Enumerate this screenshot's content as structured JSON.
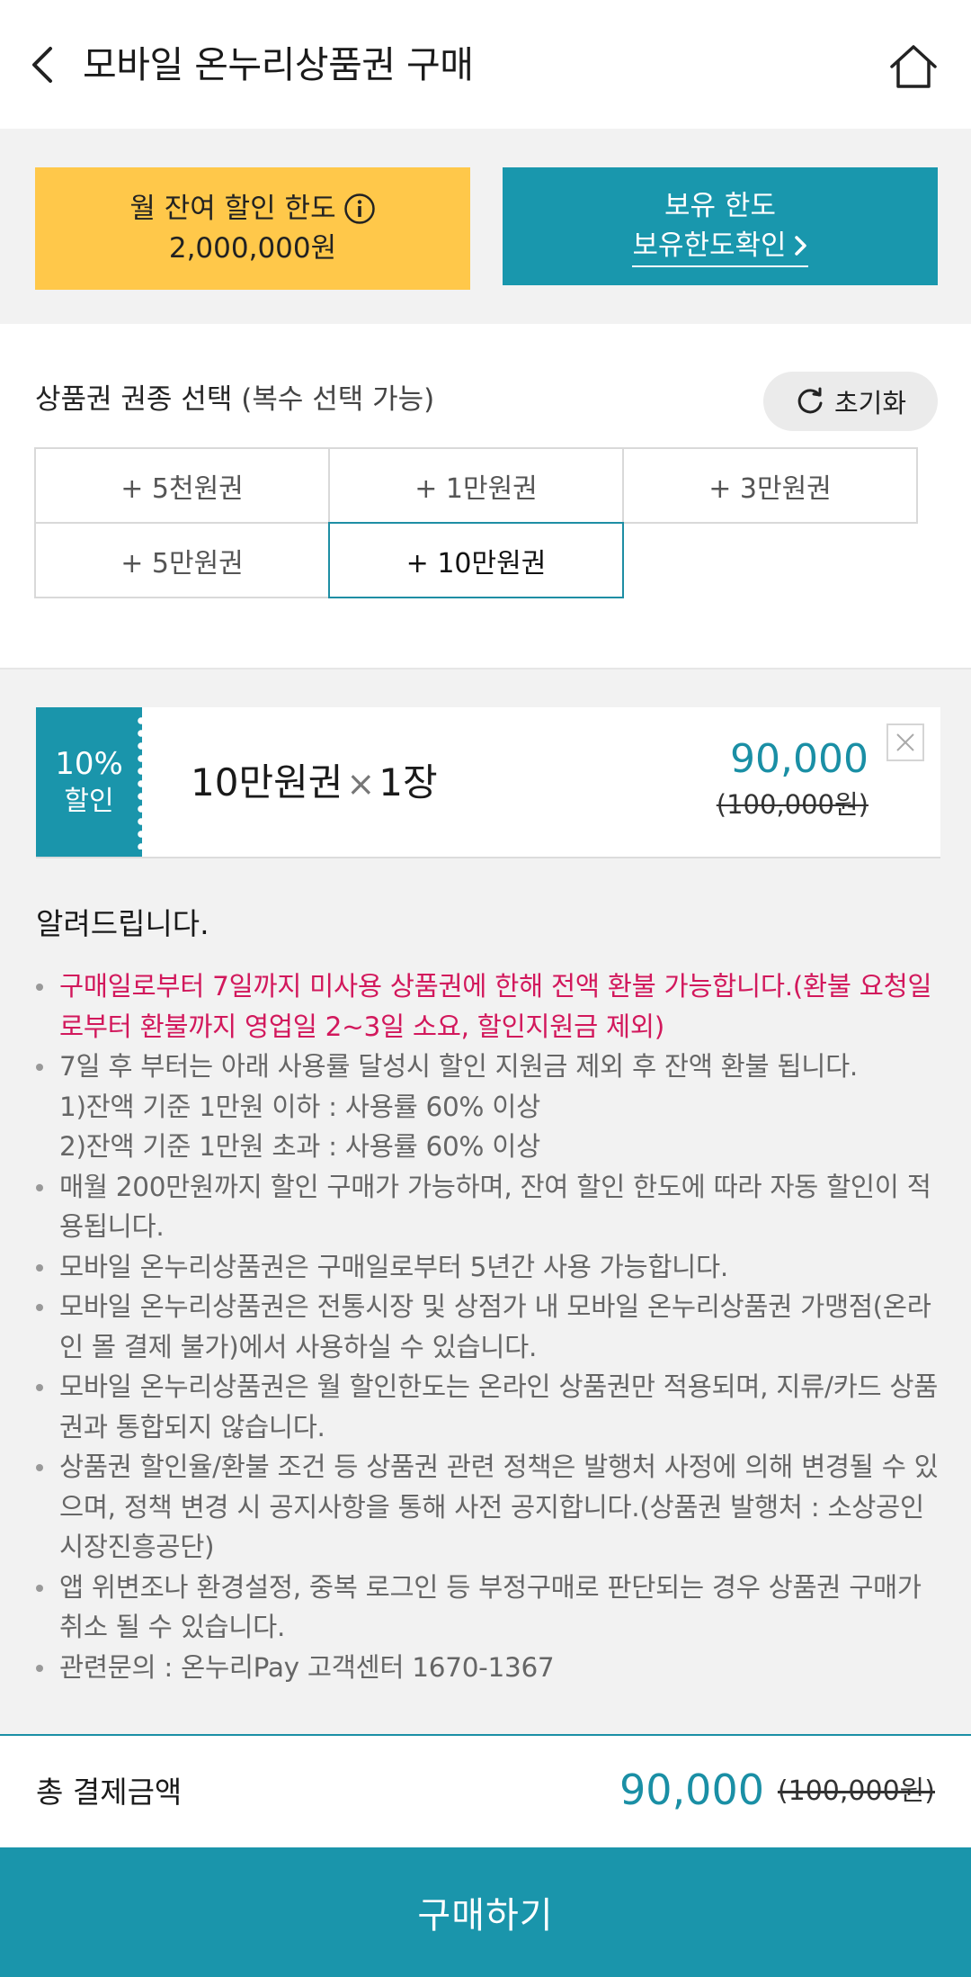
{
  "header": {
    "title": "모바일 온누리상품권 구매",
    "back_icon": "chevron-left-icon",
    "home_icon": "home-icon"
  },
  "limits": {
    "monthly_label": "월 잔여 할인 한도",
    "monthly_value": "2,000,000원",
    "holding_label": "보유 한도",
    "holding_link": "보유한도확인"
  },
  "selection": {
    "title": "상품권 권종 선택",
    "title_sub": "(복수 선택 가능)",
    "reset_label": "초기화",
    "options": [
      {
        "label": "+ 5천원권",
        "selected": false
      },
      {
        "label": "+ 1만원권",
        "selected": false
      },
      {
        "label": "+ 3만원권",
        "selected": false
      },
      {
        "label": "+ 5만원권",
        "selected": false
      },
      {
        "label": "+ 10만원권",
        "selected": true
      }
    ]
  },
  "cart": {
    "badge_percent": "10%",
    "badge_text": "할인",
    "item_name": "10만원권",
    "item_times": "×",
    "item_qty": "1장",
    "item_price": "90,000",
    "item_original": "(100,000원)"
  },
  "notice": {
    "title": "알려드립니다.",
    "items": [
      "구매일로부터 7일까지 미사용 상품권에 한해 전액 환불 가능합니다.(환불 요청일로부터 환불까지 영업일 2~3일 소요, 할인지원금 제외)",
      "7일 후 부터는 아래 사용률 달성시 할인 지원금 제외 후 잔액 환불 됩니다.",
      "1)잔액 기준 1만원 이하 : 사용률 60% 이상",
      "2)잔액 기준 1만원 초과 : 사용률 60% 이상",
      "매월 200만원까지 할인 구매가 가능하며, 잔여 할인 한도에 따라 자동 할인이 적용됩니다.",
      "모바일 온누리상품권은 구매일로부터 5년간 사용 가능합니다.",
      "모바일 온누리상품권은 전통시장 및 상점가 내 모바일 온누리상품권 가맹점(온라인 몰 결제 불가)에서 사용하실 수 있습니다.",
      "모바일 온누리상품권은 월 할인한도는 온라인 상품권만 적용되며, 지류/카드 상품권과 통합되지 않습니다.",
      "상품권 할인율/환불 조건 등 상품권 관련 정책은 발행처 사정에 의해 변경될 수 있으며, 정책 변경 시 공지사항을 통해 사전 공지합니다.(상품권 발행처 : 소상공인시장진흥공단)",
      "앱 위변조나 환경설정, 중복 로그인 등 부정구매로 판단되는 경우 상품권 구매가 취소 될 수 있습니다.",
      "관련문의 : 온누리Pay 고객센터 1670-1367"
    ]
  },
  "total": {
    "label": "총 결제금액",
    "price": "90,000",
    "original": "(100,000원)"
  },
  "buy_button": "구매하기",
  "colors": {
    "accent": "#1a95ab",
    "yellow": "#ffc84a",
    "warning": "#d2185c"
  }
}
